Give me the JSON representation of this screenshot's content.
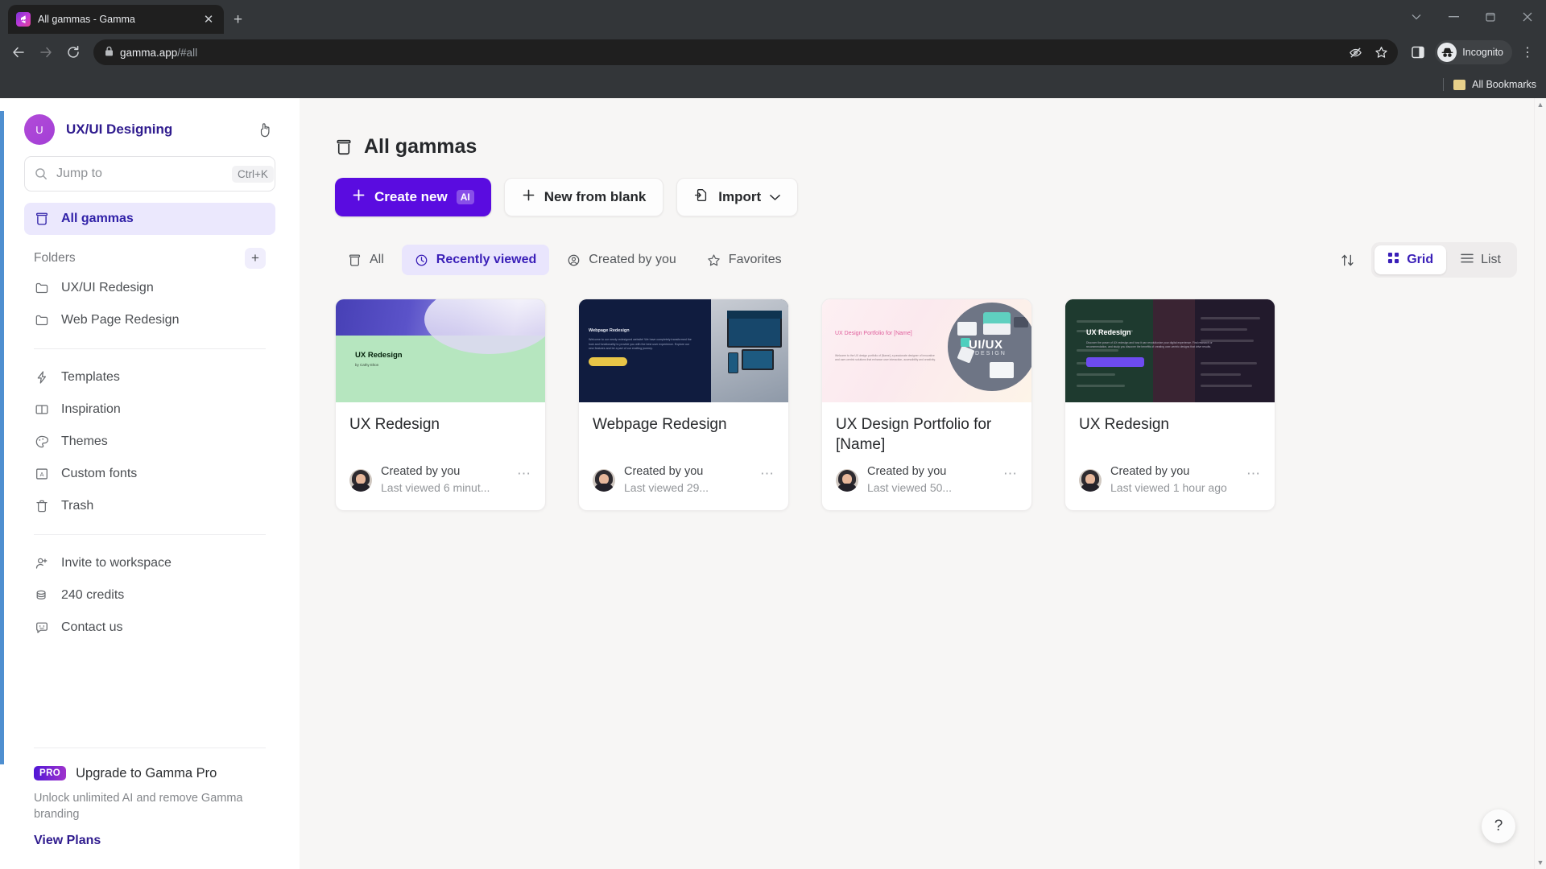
{
  "browser": {
    "tab": {
      "title": "All gammas - Gamma",
      "favicon": "gamma-logo-icon",
      "close": "✕"
    },
    "new_tab_label": "+",
    "window_controls": [
      "⌄",
      "−",
      "❐",
      "✕"
    ],
    "nav": {
      "back": "←",
      "forward": "→",
      "reload": "⟳"
    },
    "omnibox": {
      "lock": "🔒",
      "url_domain": "gamma.app",
      "url_path": "/#all",
      "hide_icon": "eye-slash-icon",
      "bookmark_icon": "☆"
    },
    "side_panel_icon": "side-panel-icon",
    "profile": {
      "label": "Incognito"
    },
    "menu_icon": "⋮",
    "bookmarks": {
      "label": "All Bookmarks"
    }
  },
  "sidebar": {
    "workspace": {
      "initial": "U",
      "name": "UX/UI Designing"
    },
    "collapse_label": "collapse-sidebar",
    "search": {
      "placeholder": "Jump to",
      "shortcut": "Ctrl+K"
    },
    "primary_nav": [
      {
        "label": "All gammas",
        "icon": "archive-icon",
        "active": true
      }
    ],
    "folders_header": {
      "title": "Folders",
      "add": "+"
    },
    "folders": [
      {
        "label": "UX/UI Redesign",
        "icon": "folder-icon"
      },
      {
        "label": "Web Page Redesign",
        "icon": "folder-icon"
      }
    ],
    "tools": [
      {
        "label": "Templates",
        "icon": "bolt-icon"
      },
      {
        "label": "Inspiration",
        "icon": "book-open-icon"
      },
      {
        "label": "Themes",
        "icon": "palette-icon"
      },
      {
        "label": "Custom fonts",
        "icon": "font-icon"
      },
      {
        "label": "Trash",
        "icon": "trash-icon"
      }
    ],
    "account": [
      {
        "label": "Invite to workspace",
        "icon": "user-plus-icon"
      },
      {
        "label": "240 credits",
        "icon": "coins-icon"
      },
      {
        "label": "Contact us",
        "icon": "chat-smile-icon"
      }
    ],
    "upgrade": {
      "badge": "PRO",
      "title": "Upgrade to Gamma Pro",
      "subtitle": "Unlock unlimited AI and remove Gamma branding",
      "link": "View Plans"
    }
  },
  "main": {
    "page_title": "All gammas",
    "page_title_icon": "archive-icon",
    "actions": [
      {
        "label": "Create new",
        "icon": "plus-icon",
        "chip": "AI",
        "style": "primary"
      },
      {
        "label": "New from blank",
        "icon": "plus-icon",
        "style": "light"
      },
      {
        "label": "Import",
        "icon": "import-icon",
        "caret": "⌄",
        "style": "light"
      }
    ],
    "filters": [
      {
        "label": "All",
        "icon": "archive-icon",
        "active": false
      },
      {
        "label": "Recently viewed",
        "icon": "clock-icon",
        "active": true
      },
      {
        "label": "Created by you",
        "icon": "user-circle-icon",
        "active": false
      },
      {
        "label": "Favorites",
        "icon": "star-icon",
        "active": false
      }
    ],
    "sort_icon": "sort-arrows-icon",
    "view_modes": [
      {
        "label": "Grid",
        "icon": "grid-icon",
        "active": true
      },
      {
        "label": "List",
        "icon": "list-icon",
        "active": false
      }
    ],
    "cards": [
      {
        "title": "UX Redesign",
        "author": "Created by you",
        "viewed": "Last viewed 6 minut...",
        "menu": "⋯",
        "thumb": {
          "heading": "UX Redesign",
          "sub": "by Cathy Elton"
        }
      },
      {
        "title": "Webpage Redesign",
        "author": "Created by you",
        "viewed": "Last viewed 29...",
        "menu": "⋯",
        "thumb": {
          "heading": "Webpage Redesign",
          "sub": "Welcome to our newly redesigned website! We have completely transformed the look and functionality to provide you with the best user experience. Explore our new features and be a part of our exciting journey.",
          "cta": "Discover More"
        }
      },
      {
        "title": "UX Design Portfolio for [Name]",
        "author": "Created by you",
        "viewed": "Last viewed 50...",
        "menu": "⋯",
        "thumb": {
          "heading": "UX Design Portfolio for [Name]",
          "sub": "Welcome to the UX design portfolio of [Name], a passionate designer of innovative and user-centric solutions that enhance user interaction, accessibility and creativity.",
          "label": "UI/UX",
          "label2": "DESIGN"
        }
      },
      {
        "title": "UX Redesign",
        "author": "Created by you",
        "viewed": "Last viewed 1 hour ago",
        "menu": "⋯",
        "thumb": {
          "heading": "UX Redesign",
          "sub": "Discover the power of UX redesign and how it can revolutionize your digital experience. Find research or recommendation, and study you discover the benefits of creating user-centric designs that drive results.",
          "cta": "Start the Redesign Journey"
        }
      }
    ],
    "help_button": "?"
  }
}
